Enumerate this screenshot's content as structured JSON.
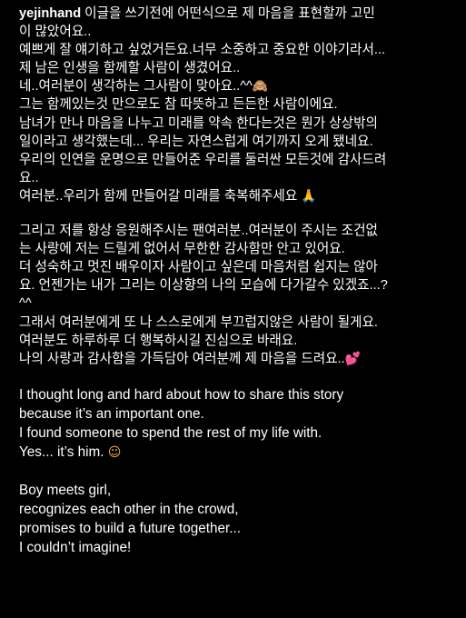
{
  "post": {
    "username": "yejinhand",
    "korean_paragraph_1": [
      "이글을 쓰기전에 어떤식으로 제 마음을 표현할까 고민",
      "이 많았어요..",
      "예쁘게 잘 얘기하고 싶었거든요.너무 소중하고 중요한 이야기라서...",
      "제 남은 인생을 함께할 사람이 생겼어요..",
      "네..여러분이 생각하는 그사람이 맞아요..^^",
      "그는 함께있는것 만으로도 참 따뜻하고 든든한 사람이에요.",
      "남녀가 만나 마음을 나누고 미래를 약속 한다는것은  뭔가 상상밖의",
      "일이라고 생각했는데... 우리는 자연스럽게 여기까지 오게 됐네요.",
      "우리의 인연을 운명으로 만들어준 우리를 둘러싼 모든것에 감사드려",
      "요..",
      "여러분..우리가 함께 만들어갈 미래를 축복해주세요"
    ],
    "korean_paragraph_2": [
      "그리고 저를 항상 응원해주시는 팬여러분..여러분이 주시는 조건없",
      "는 사랑에 저는 드릴게 없어서 무한한 감사함만 안고 있어요.",
      "더 성숙하고 멋진 배우이자 사람이고 싶은데 마음처럼 쉽지는 않아",
      "요. 언젠가는 내가 그리는 이상향의 나의 모습에 다가갈수 있겠죠...?",
      "^^",
      "그래서 여러분에게 또 나 스스로에게 부끄럽지않은 사람이 될게요.",
      "여러분도 하루하루 더 행복하시길 진심으로 바래요.",
      "나의 사랑과 감사함을 가득담아 여러분께 제 마음을 드려요.."
    ],
    "english_paragraph_1": [
      "I thought long and hard about how to share this story",
      "because it’s an important one.",
      "I found someone to spend the rest of my life with.",
      "Yes... it’s him."
    ],
    "english_paragraph_2": [
      "Boy meets girl,",
      "recognizes each other in the crowd,",
      "promises to build a future together...",
      "I couldn’t imagine!"
    ],
    "emojis": {
      "monkey": "🙈",
      "pray": "🙏",
      "hearts": "💕",
      "relieved": "☺"
    }
  }
}
